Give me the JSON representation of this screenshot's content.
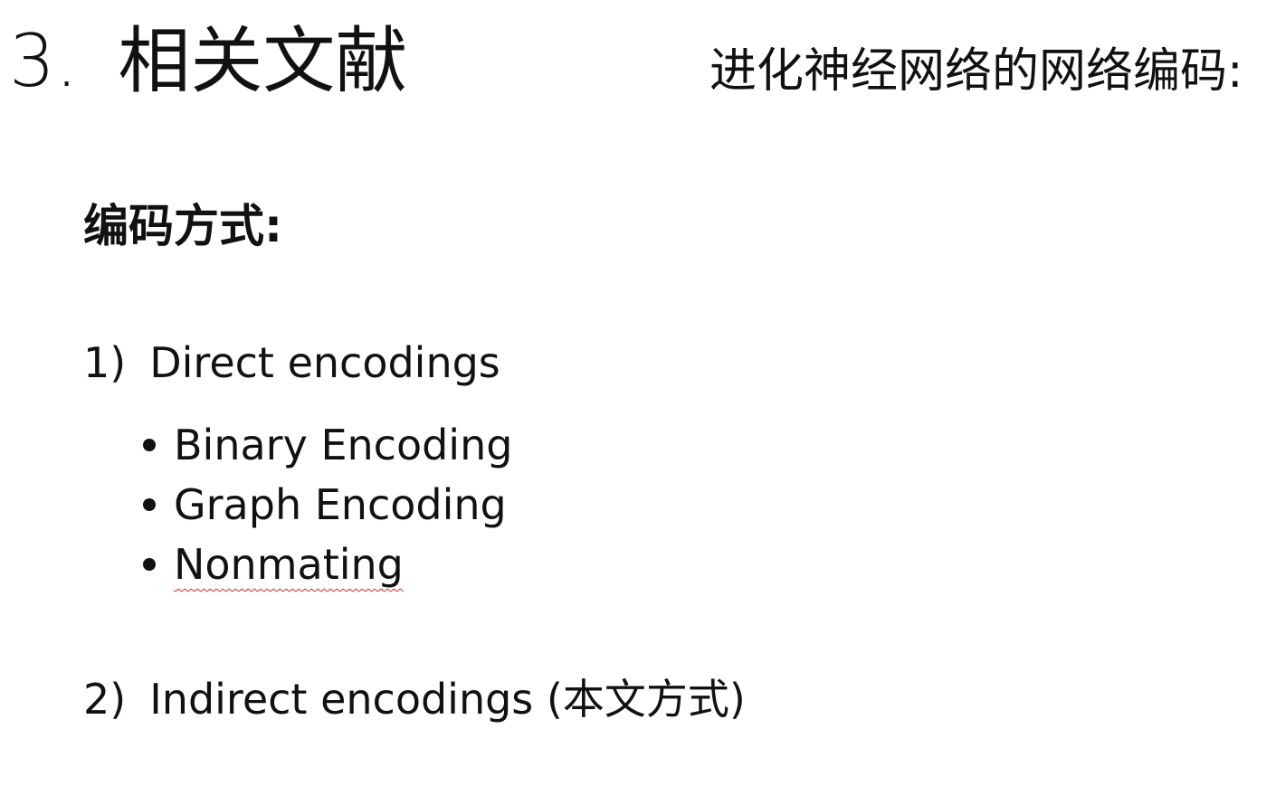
{
  "header": {
    "section_number": "3.",
    "title": "相关文献",
    "subtitle": "进化神经网络的网络编码:"
  },
  "content": {
    "heading": "编码方式:",
    "items": [
      {
        "marker": "1)",
        "label": "Direct encodings",
        "subitems": [
          "Binary Encoding",
          "Graph Encoding",
          "Nonmating"
        ]
      },
      {
        "marker": "2)",
        "label": "Indirect encodings  (本文方式)"
      }
    ]
  },
  "colors": {
    "text": "#111111",
    "spellcheck_underline": "#e02020"
  }
}
